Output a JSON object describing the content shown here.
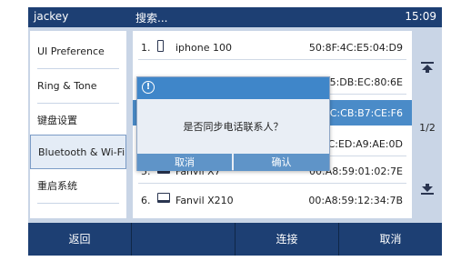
{
  "topbar": {
    "user": "jackey",
    "search": "搜索...",
    "time": "15:09"
  },
  "menu": {
    "items": [
      {
        "label": "UI Preference"
      },
      {
        "label": "Ring & Tone"
      },
      {
        "label": "键盘设置"
      },
      {
        "label": "Bluetooth & Wi-Fi",
        "active": true
      },
      {
        "label": "重启系统"
      }
    ]
  },
  "list": {
    "rows": [
      {
        "num": "1.",
        "icon": "phone-icon",
        "name": "iphone 100",
        "mac": "50:8F:4C:E5:04:D9"
      },
      {
        "num": "",
        "icon": "",
        "name": "",
        "mac": "F5:DB:EC:80:6E"
      },
      {
        "num": "",
        "icon": "",
        "name": "",
        "mac": "AC:CB:B7:CE:F6"
      },
      {
        "num": "",
        "icon": "",
        "name": "",
        "mac": "9C:ED:A9:AE:0D"
      },
      {
        "num": "5.",
        "icon": "computer-icon",
        "name": "Fanvil X7",
        "mac": "00:A8:59:01:02:7E"
      },
      {
        "num": "6.",
        "icon": "computer-icon",
        "name": "Fanvil X210",
        "mac": "00:A8:59:12:34:7B"
      }
    ],
    "highlight_index": 2
  },
  "scroll": {
    "page": "1/2",
    "up_icon": "page-up-icon",
    "down_icon": "page-down-icon"
  },
  "softkeys": {
    "back": "返回",
    "blank": "",
    "connect": "连接",
    "cancel": "取消"
  },
  "dialog": {
    "info_icon": "info-icon",
    "info_glyph": "!",
    "message": "是否同步电话联系人？",
    "cancel": "取消",
    "confirm": "确认"
  },
  "colors": {
    "bar": "#1d3f73",
    "screen_bg": "#c9d5e6",
    "highlight": "#4a8bc8",
    "dialog_header": "#3f86c9"
  }
}
